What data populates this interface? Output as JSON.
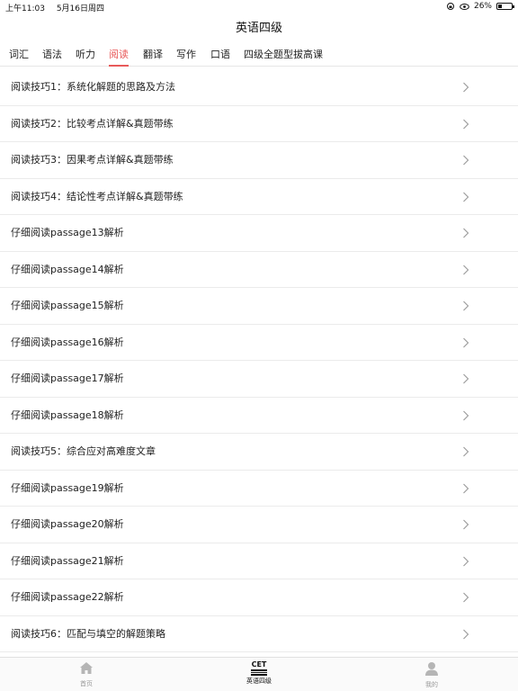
{
  "status_bar": {
    "time": "上午11:03",
    "date": "5月16日周四",
    "battery": "26%",
    "battery_level": 0.26
  },
  "header": {
    "title": "英语四级"
  },
  "tabs": [
    {
      "label": "词汇",
      "active": false
    },
    {
      "label": "语法",
      "active": false
    },
    {
      "label": "听力",
      "active": false
    },
    {
      "label": "阅读",
      "active": true
    },
    {
      "label": "翻译",
      "active": false
    },
    {
      "label": "写作",
      "active": false
    },
    {
      "label": "口语",
      "active": false
    },
    {
      "label": "四级全题型拔高课",
      "active": false
    }
  ],
  "list": {
    "items": [
      "阅读技巧1：系统化解题的思路及方法",
      "阅读技巧2：比较考点详解&真题带练",
      "阅读技巧3：因果考点详解&真题带练",
      "阅读技巧4：结论性考点详解&真题带练",
      "仔细阅读passage13解析",
      "仔细阅读passage14解析",
      "仔细阅读passage15解析",
      "仔细阅读passage16解析",
      "仔细阅读passage17解析",
      "仔细阅读passage18解析",
      "阅读技巧5：综合应对高难度文章",
      "仔细阅读passage19解析",
      "仔细阅读passage20解析",
      "仔细阅读passage21解析",
      "仔细阅读passage22解析",
      "阅读技巧6：匹配与填空的解题策略"
    ]
  },
  "tabbar": {
    "home": {
      "label": "首页",
      "icon": "home-icon"
    },
    "cet": {
      "label": "英语四级",
      "icon_text": "CET"
    },
    "me": {
      "label": "我的",
      "icon": "user-icon"
    }
  },
  "colors": {
    "accent": "#e85a5a",
    "divider": "#ebebeb"
  }
}
